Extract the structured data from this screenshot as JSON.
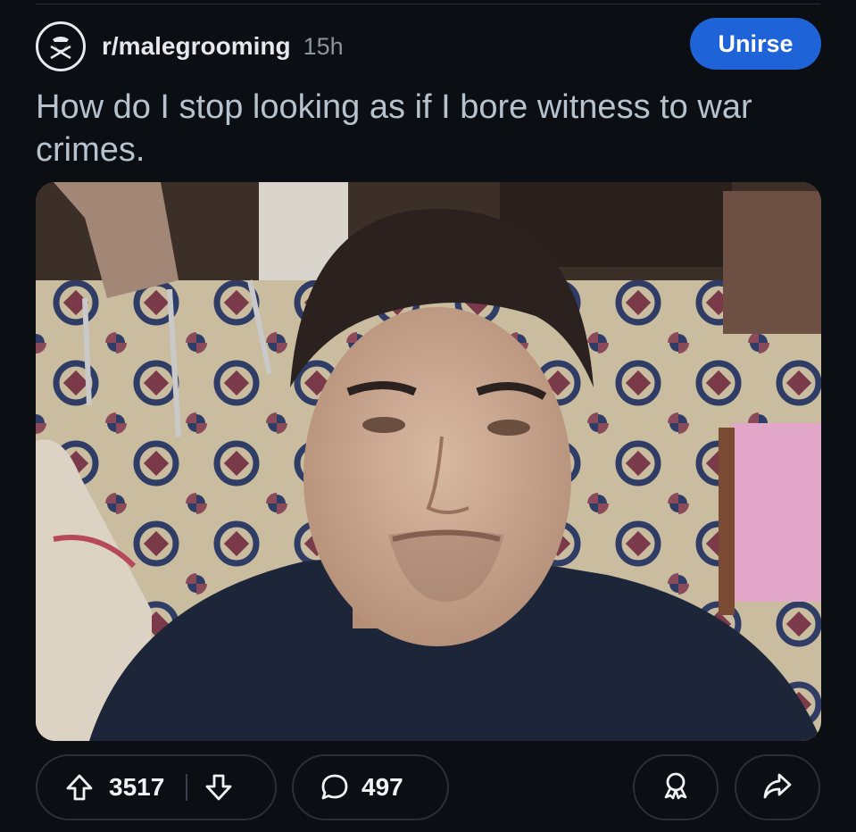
{
  "post": {
    "subreddit": "r/malegrooming",
    "time_ago": "15h",
    "join_label": "Unirse",
    "title": "How do I stop looking as if I bore witness to war crimes."
  },
  "actions": {
    "upvotes": "3517",
    "comments": "497"
  },
  "icons": {
    "avatar": "subreddit-logo-icon",
    "upvote": "arrow-up-icon",
    "downvote": "arrow-down-icon",
    "comment": "comment-bubble-icon",
    "award": "award-icon",
    "share": "share-arrow-icon"
  },
  "colors": {
    "background": "#0b0e12",
    "accent": "#1e63d7",
    "title": "#b6c2ce"
  }
}
